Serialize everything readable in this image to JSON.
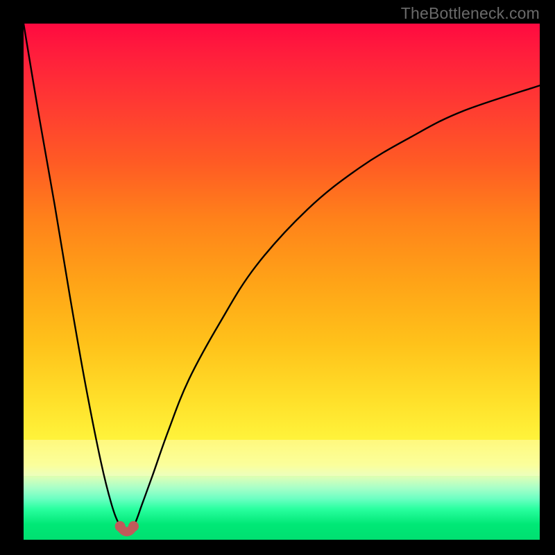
{
  "watermark": {
    "text": "TheBottleneck.com"
  },
  "colors": {
    "frame_bg": "#000000",
    "curve_stroke": "#000000",
    "marker_fill": "#c05a5a",
    "marker_stroke": "#c05a5a",
    "gradient_top": "#ff1335",
    "gradient_mid": "#ffcc1f",
    "gradient_bottom": "#00e576"
  },
  "chart_data": {
    "type": "line",
    "title": "",
    "xlabel": "",
    "ylabel": "",
    "xlim": [
      0,
      100
    ],
    "ylim": [
      0,
      100
    ],
    "grid": false,
    "legend": null,
    "notes": "Bottleneck-style V curve. Y is inverted visually (0 at top, 100 at bottom). Minimum (best) at x≈20. Curve rises steeply on both sides; values are approximate readings from the gradient / pixel positions. Pink markers sit at the floor of the V.",
    "series": [
      {
        "name": "curve",
        "x": [
          0,
          3,
          6,
          9,
          12,
          15,
          17,
          18.5,
          20,
          21.5,
          23,
          25,
          28,
          32,
          38,
          45,
          55,
          65,
          75,
          85,
          100
        ],
        "y": [
          0,
          18,
          35,
          53,
          70,
          85,
          93,
          97,
          99,
          97,
          93,
          87.5,
          79,
          69,
          58,
          47,
          36,
          28,
          22,
          17,
          12
        ]
      }
    ],
    "markers": [
      {
        "x": 18.7,
        "y": 97.4
      },
      {
        "x": 21.3,
        "y": 97.4
      }
    ],
    "marker_connector": {
      "from_x": 18.7,
      "to_x": 21.3,
      "y": 98.6
    }
  }
}
